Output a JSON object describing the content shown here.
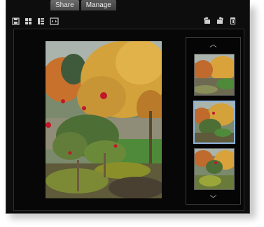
{
  "tabs": [
    {
      "label": "Share",
      "active": false
    },
    {
      "label": "Manage",
      "active": true
    }
  ],
  "toolbar_left_icons": [
    "save-icon",
    "grid-view-icon",
    "list-view-icon",
    "fit-view-icon"
  ],
  "toolbar_right_icons": [
    "rotate-left-icon",
    "rotate-right-icon",
    "delete-icon"
  ],
  "thumbnails": [
    {
      "name": "thumbnail-1",
      "selected": false
    },
    {
      "name": "thumbnail-2",
      "selected": true
    },
    {
      "name": "thumbnail-3",
      "selected": false
    }
  ],
  "colors": {
    "window_bg": "#0d0d0d",
    "selection_border": "#8fb3d9",
    "tab_bg": "#5a5a5a"
  }
}
